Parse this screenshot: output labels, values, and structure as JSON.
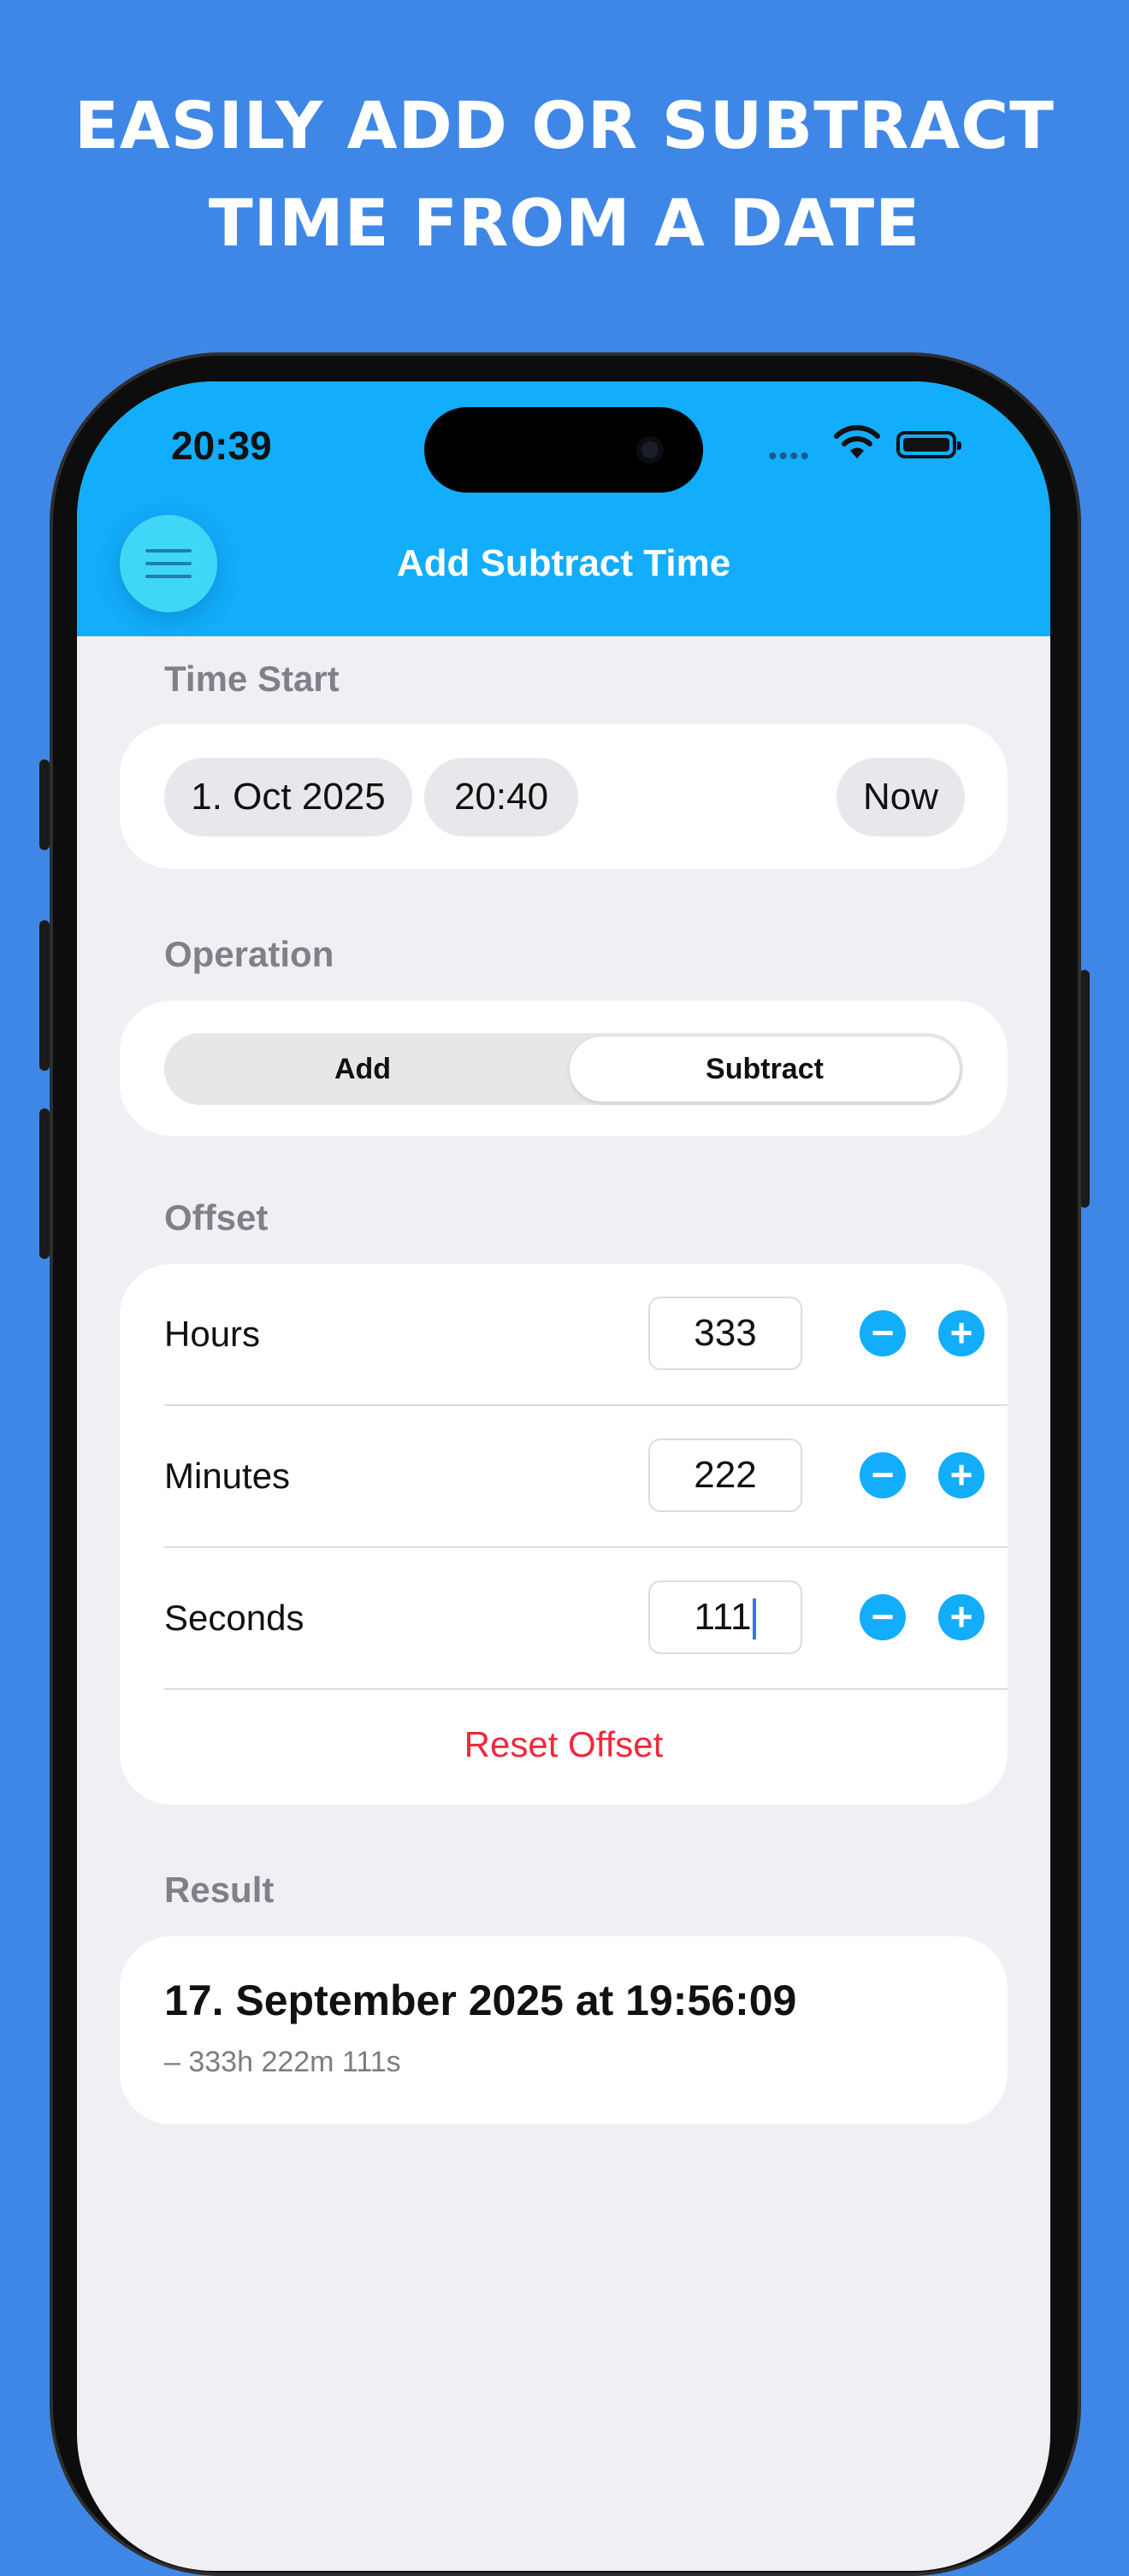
{
  "promo": {
    "line1": "EASILY ADD OR SUBTRACT",
    "line2": "TIME FROM A DATE"
  },
  "status_bar": {
    "time": "20:39",
    "icons": [
      "cellular-icon",
      "wifi-icon",
      "battery-icon"
    ]
  },
  "nav": {
    "title": "Add Subtract Time",
    "menu_icon": "hamburger-menu-icon"
  },
  "time_start": {
    "label": "Time Start",
    "date": "1. Oct 2025",
    "time": "20:40",
    "now_label": "Now"
  },
  "operation": {
    "label": "Operation",
    "options": [
      "Add",
      "Subtract"
    ],
    "selected": "Subtract"
  },
  "offset": {
    "label": "Offset",
    "rows": [
      {
        "label": "Hours",
        "value": "333"
      },
      {
        "label": "Minutes",
        "value": "222"
      },
      {
        "label": "Seconds",
        "value": "111"
      }
    ],
    "reset_label": "Reset Offset"
  },
  "result": {
    "label": "Result",
    "value": "17. September 2025 at 19:56:09",
    "detail": "– 333h 222m 111s"
  },
  "colors": {
    "background": "#3f87e6",
    "accent": "#12adfb",
    "destructive": "#f0283c"
  }
}
